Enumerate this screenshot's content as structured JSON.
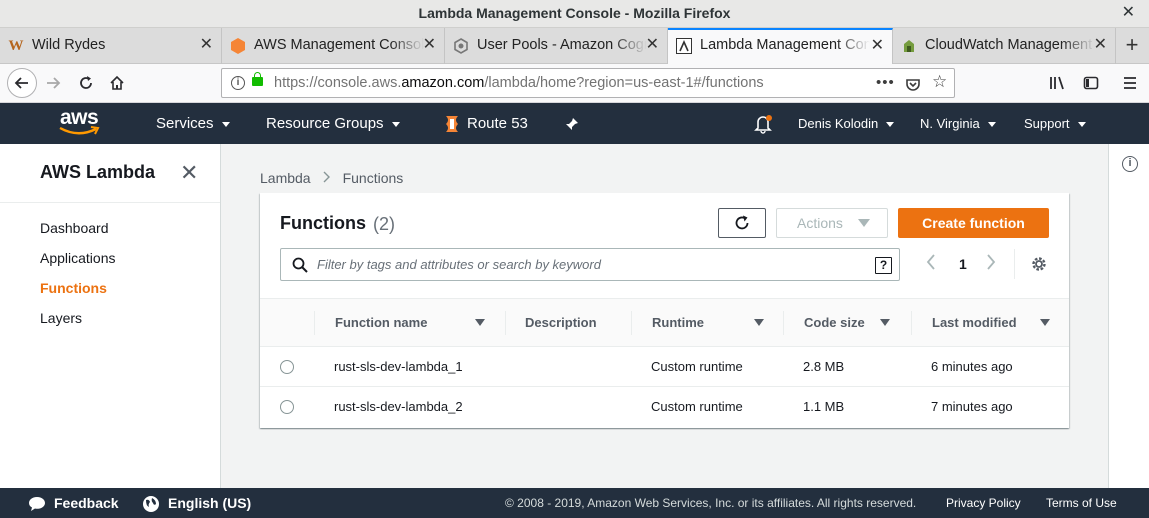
{
  "window": {
    "title": "Lambda Management Console - Mozilla Firefox",
    "close_glyph": "✕"
  },
  "tabs": [
    {
      "title": "Wild Rydes",
      "icon": "wild-rydes-w-icon"
    },
    {
      "title": "AWS Management Console",
      "icon": "aws-orange-hexagon-icon"
    },
    {
      "title": "User Pools - Amazon Cognito",
      "icon": "cognito-icon"
    },
    {
      "title": "Lambda Management Console",
      "icon": "lambda-icon",
      "active": true
    },
    {
      "title": "CloudWatch Management Console",
      "icon": "cloudwatch-icon"
    }
  ],
  "browser": {
    "url_prefix": "https://console.aws.",
    "url_domain": "amazon.com",
    "url_suffix": "/lambda/home?region=us-east-1#/functions",
    "page_actions": "•••"
  },
  "aws_nav": {
    "logo_text": "aws",
    "services": "Services",
    "resource_groups": "Resource Groups",
    "pinned": "Route 53",
    "user": "Denis Kolodin",
    "region": "N. Virginia",
    "support": "Support"
  },
  "sidebar": {
    "title": "AWS Lambda",
    "items": [
      {
        "label": "Dashboard"
      },
      {
        "label": "Applications"
      },
      {
        "label": "Functions",
        "active": true
      },
      {
        "label": "Layers"
      }
    ]
  },
  "breadcrumb": [
    "Lambda",
    "Functions"
  ],
  "functions_panel": {
    "title": "Functions",
    "count": "(2)",
    "actions_label": "Actions",
    "create_label": "Create function",
    "filter_placeholder": "Filter by tags and attributes or search by keyword",
    "help_glyph": "?",
    "page": "1"
  },
  "table": {
    "columns": [
      "Function name",
      "Description",
      "Runtime",
      "Code size",
      "Last modified"
    ],
    "rows": [
      {
        "name": "rust-sls-dev-lambda_1",
        "description": "",
        "runtime": "Custom runtime",
        "code_size": "2.8 MB",
        "last_modified": "6 minutes ago"
      },
      {
        "name": "rust-sls-dev-lambda_2",
        "description": "",
        "runtime": "Custom runtime",
        "code_size": "1.1 MB",
        "last_modified": "7 minutes ago"
      }
    ]
  },
  "footer": {
    "feedback": "Feedback",
    "language": "English (US)",
    "copyright": "© 2008 - 2019, Amazon Web Services, Inc. or its affiliates. All rights reserved.",
    "privacy": "Privacy Policy",
    "terms": "Terms of Use"
  },
  "colors": {
    "accent": "#ec7211",
    "nav_bg": "#232f3e",
    "firefox_blue": "#0a84ff"
  }
}
